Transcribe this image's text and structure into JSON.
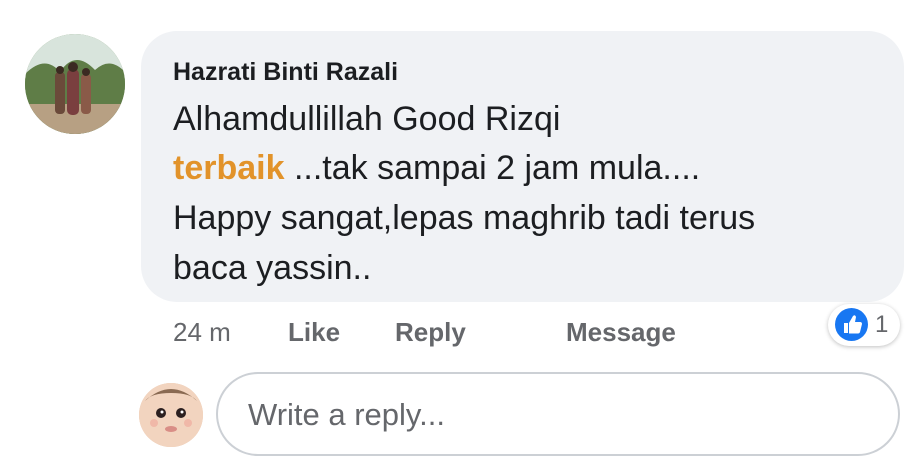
{
  "comment": {
    "author": "Hazrati Binti Razali",
    "lines": [
      "Alhamdullillah Good Rizqi",
      "...tak sampai 2 jam mula....",
      "Happy sangat,lepas maghrib tadi terus",
      "baca yassin.."
    ],
    "highlight_word": "terbaik",
    "time": "24 m",
    "like_label": "Like",
    "reply_label": "Reply",
    "message_label": "Message",
    "reaction_icon": "like-icon",
    "reaction_count": "1"
  },
  "reply": {
    "placeholder": "Write a reply..."
  },
  "colors": {
    "bubble": "#f0f2f5",
    "highlight": "#e2932a",
    "like_blue": "#1877f2",
    "meta_text": "#65676b"
  }
}
